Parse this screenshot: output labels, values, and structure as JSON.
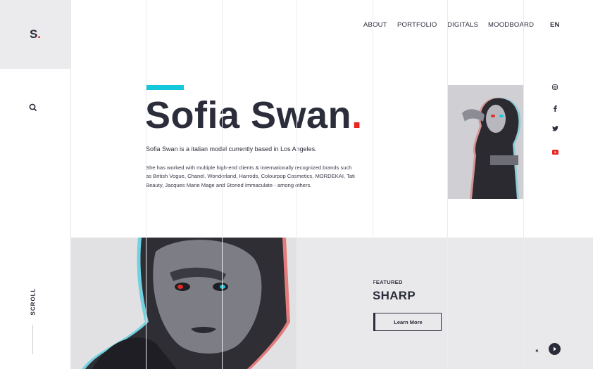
{
  "brand": {
    "letter": "S",
    "dot": "."
  },
  "nav": {
    "items": [
      "ABOUT",
      "PORTFOLIO",
      "DIGITALS",
      "MOODBOARD"
    ],
    "language": "EN"
  },
  "hero": {
    "name": "Sofia Swan",
    "dot": ".",
    "intro": "Sofia Swan is a italian model currently based in Los Angeles.",
    "bio": "She has worked with multiple high-end clients & internationally recognized brands such as British Vogue, Chanel, Wonderland, Harrods, Colourpop Cosmetics, MORDEKAI, Tati Beauty, Jacques Marie Mage and Stoned Immaculate - among others."
  },
  "socials": [
    "instagram-icon",
    "facebook-icon",
    "twitter-icon",
    "youtube-icon"
  ],
  "scroll_label": "SCROLL",
  "featured": {
    "label": "FEATURED",
    "title": "SHARP",
    "button": "Learn More"
  },
  "colors": {
    "accent_cyan": "#14c8dc",
    "accent_red": "#e8261f",
    "ink": "#2b2d3a",
    "panel": "#ebebed"
  }
}
